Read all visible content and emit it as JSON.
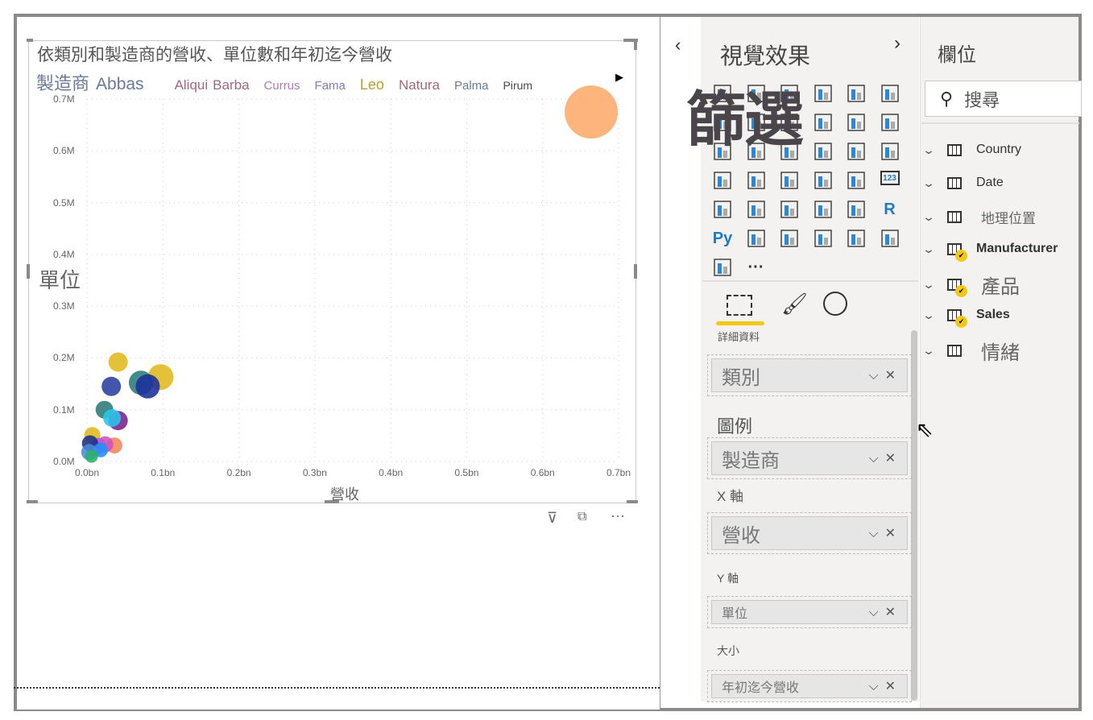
{
  "visual": {
    "title": "依類別和製造商的營收、單位數和年初迄今營收",
    "legend": {
      "title": "製造商",
      "items": [
        {
          "name": "Abbas",
          "color": "#6b7a99"
        },
        {
          "name": "Aliqui",
          "color": "#a0697d"
        },
        {
          "name": "Barba",
          "color": "#a0697d"
        },
        {
          "name": "Currus",
          "color": "#b07ab0"
        },
        {
          "name": "Fama",
          "color": "#8a7ab0"
        },
        {
          "name": "Leo",
          "color": "#b8a030"
        },
        {
          "name": "Natura",
          "color": "#a0697d"
        },
        {
          "name": "Palma",
          "color": "#6a7f8f"
        },
        {
          "name": "Pirum",
          "color": "#4a4a4a"
        }
      ]
    },
    "footer_icons": [
      "filter-icon",
      "focus-mode-icon",
      "more-options-icon"
    ]
  },
  "chart_data": {
    "type": "scatter",
    "xlabel": "營收",
    "ylabel": "單位",
    "xlim": [
      0,
      0.7
    ],
    "ylim": [
      0,
      0.7
    ],
    "grid": true,
    "x_ticks": [
      "0.0bn",
      "0.1bn",
      "0.2bn",
      "0.3bn",
      "0.4bn",
      "0.5bn",
      "0.6bn",
      "0.7bn"
    ],
    "y_ticks": [
      "0.0M",
      "0.1M",
      "0.2M",
      "0.3M",
      "0.4M",
      "0.5M",
      "0.6M",
      "0.7M"
    ],
    "points": [
      {
        "x": 0.664,
        "y": 0.675,
        "size": 33,
        "color": "#fdab6b"
      },
      {
        "x": 0.041,
        "y": 0.192,
        "size": 12,
        "color": "#e0b81c"
      },
      {
        "x": 0.097,
        "y": 0.163,
        "size": 16,
        "color": "#e0b81c"
      },
      {
        "x": 0.071,
        "y": 0.152,
        "size": 15,
        "color": "#2a7a78"
      },
      {
        "x": 0.08,
        "y": 0.145,
        "size": 15,
        "color": "#1a2f9a"
      },
      {
        "x": 0.032,
        "y": 0.145,
        "size": 12,
        "color": "#2a3fa0"
      },
      {
        "x": 0.023,
        "y": 0.1,
        "size": 11,
        "color": "#2a7a78"
      },
      {
        "x": 0.041,
        "y": 0.079,
        "size": 12,
        "color": "#7a1f8a"
      },
      {
        "x": 0.033,
        "y": 0.084,
        "size": 11,
        "color": "#29c5e8"
      },
      {
        "x": 0.007,
        "y": 0.051,
        "size": 10,
        "color": "#e0b81c"
      },
      {
        "x": 0.036,
        "y": 0.031,
        "size": 10,
        "color": "#f0885a"
      },
      {
        "x": 0.024,
        "y": 0.033,
        "size": 10,
        "color": "#d050c0"
      },
      {
        "x": 0.015,
        "y": 0.03,
        "size": 10,
        "color": "#b85ad0"
      },
      {
        "x": 0.004,
        "y": 0.035,
        "size": 10,
        "color": "#1a2f8a"
      },
      {
        "x": 0.018,
        "y": 0.022,
        "size": 9,
        "color": "#1e90ff"
      },
      {
        "x": 0.003,
        "y": 0.018,
        "size": 10,
        "color": "#4a8ad8"
      },
      {
        "x": 0.006,
        "y": 0.01,
        "size": 8,
        "color": "#2ab06a"
      }
    ]
  },
  "viz_pane": {
    "title": "視覺效果",
    "overlay": "篩選",
    "tabs": [
      {
        "label": "詳細資料",
        "active": true
      },
      {
        "label": ""
      },
      {
        "label": ""
      }
    ],
    "wells": [
      {
        "label": "",
        "value": "類別"
      },
      {
        "label": "圖例",
        "value": "製造商"
      },
      {
        "label": "X 軸",
        "value": "營收"
      },
      {
        "label": "Y 軸",
        "value": "單位"
      },
      {
        "label": "大小",
        "value": "年初迄今營收"
      }
    ],
    "icons": [
      "stacked-bar-icon",
      "stacked-column-icon",
      "clustered-bar-icon",
      "clustered-column-icon",
      "100-bar-icon",
      "100-column-icon",
      "line-icon",
      "area-icon",
      "stacked-area-icon",
      "line-column-icon",
      "line-clustered-column-icon",
      "ribbon-icon",
      "waterfall-icon",
      "funnel-icon",
      "scatter-icon",
      "pie-icon",
      "donut-icon",
      "treemap-icon",
      "map-icon",
      "filled-map-icon",
      "shape-map-icon",
      "azure-map-icon",
      "gauge-icon",
      "card-icon",
      "multirow-card-icon",
      "kpi-icon",
      "slicer-icon",
      "table-icon",
      "matrix-icon",
      "r-visual-icon",
      "python-visual-icon",
      "key-influencers-icon",
      "decomposition-tree-icon",
      "qa-icon",
      "paginated-report-icon",
      "arcgis-icon",
      "power-apps-icon",
      "more-visuals-icon"
    ],
    "icon_glyphs": {
      "r-visual-icon": "R",
      "python-visual-icon": "Py",
      "card-icon": "123",
      "more-visuals-icon": "···"
    }
  },
  "fields_pane": {
    "title": "欄位",
    "search_placeholder": "搜尋",
    "tables": [
      {
        "name": "Country",
        "checked": false
      },
      {
        "name": "Date",
        "checked": false
      },
      {
        "name": "地理位置",
        "checked": false
      },
      {
        "name": "Manufacturer",
        "checked": true
      },
      {
        "name": "產品",
        "checked": true
      },
      {
        "name": "Sales",
        "checked": true
      },
      {
        "name": "情緒",
        "checked": false
      }
    ]
  }
}
